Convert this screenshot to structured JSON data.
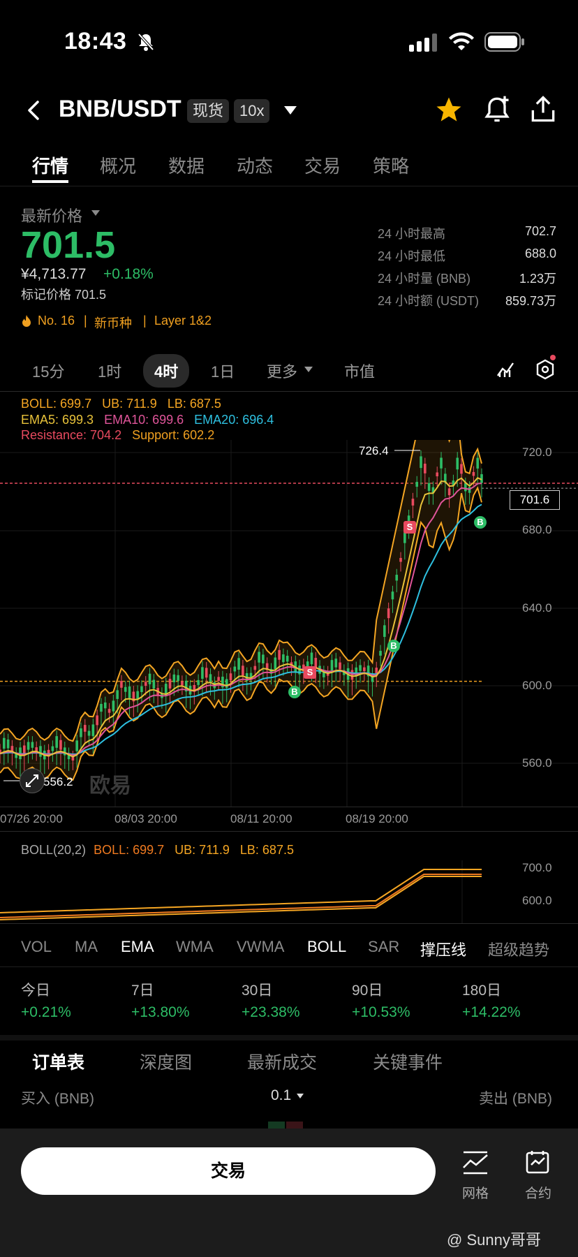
{
  "status": {
    "time": "18:43"
  },
  "header": {
    "pair": "BNB/USDT",
    "spot_tag": "现货",
    "leverage_tag": "10x"
  },
  "tabs": [
    "行情",
    "概况",
    "数据",
    "动态",
    "交易",
    "策略"
  ],
  "price": {
    "label": "最新价格",
    "last": "701.5",
    "cny": "¥4,713.77",
    "change": "+0.18%",
    "mark": "标记价格 701.5",
    "rank": "No. 16",
    "tag1": "新币种",
    "tag2": "Layer 1&2"
  },
  "stats": [
    {
      "label": "24 小时最高",
      "value": "702.7"
    },
    {
      "label": "24 小时最低",
      "value": "688.0"
    },
    {
      "label": "24 小时量 (BNB)",
      "value": "1.23万"
    },
    {
      "label": "24 小时额 (USDT)",
      "value": "859.73万"
    }
  ],
  "timeframes": [
    "15分",
    "1时",
    "4时",
    "1日",
    "更多",
    "市值"
  ],
  "indicators": {
    "boll": "BOLL: 699.7",
    "ub": "UB: 711.9",
    "lb": "LB: 687.5",
    "ema5": "EMA5: 699.3",
    "ema10": "EMA10: 699.6",
    "ema20": "EMA20: 696.4",
    "resistance": "Resistance: 704.2",
    "support": "Support: 602.2"
  },
  "chart": {
    "y_ticks": [
      "720.0",
      "680.0",
      "640.0",
      "600.0",
      "560.0"
    ],
    "x_ticks": [
      "07/26 20:00",
      "08/03 20:00",
      "08/11 20:00",
      "08/19 20:00"
    ],
    "high_label": "726.4",
    "low_label": "556.2",
    "current_label": "701.6",
    "watermark": "欧易",
    "signal_s": "S",
    "signal_b": "B"
  },
  "sub_chart": {
    "title": "BOLL(20,2)",
    "boll": "BOLL: 699.7",
    "ub": "UB: 711.9",
    "lb": "LB: 687.5",
    "y_ticks": [
      "700.0",
      "600.0"
    ]
  },
  "indicator_tabs": [
    "VOL",
    "MA",
    "EMA",
    "WMA",
    "VWMA",
    "BOLL",
    "SAR",
    "撑压线",
    "超级趋势"
  ],
  "performance": [
    {
      "label": "今日",
      "value": "+0.21%"
    },
    {
      "label": "7日",
      "value": "+13.80%"
    },
    {
      "label": "30日",
      "value": "+23.38%"
    },
    {
      "label": "90日",
      "value": "+10.53%"
    },
    {
      "label": "180日",
      "value": "+14.22%"
    }
  ],
  "orderbook": {
    "tabs": [
      "订单表",
      "深度图",
      "最新成交",
      "关键事件"
    ],
    "buy_label": "买入 (BNB)",
    "precision": "0.1",
    "sell_label": "卖出 (BNB)"
  },
  "bottom": {
    "trade": "交易",
    "grid": "网格",
    "contract": "合约",
    "watermark": "@ Sunny哥哥"
  },
  "colors": {
    "up": "#2dbd66",
    "accent": "#f0a020",
    "boll": "#f5a623",
    "ema5": "#e8c23a",
    "ema10": "#e0559a",
    "ema20": "#2ec0e0",
    "resistance": "#e84a5f"
  }
}
